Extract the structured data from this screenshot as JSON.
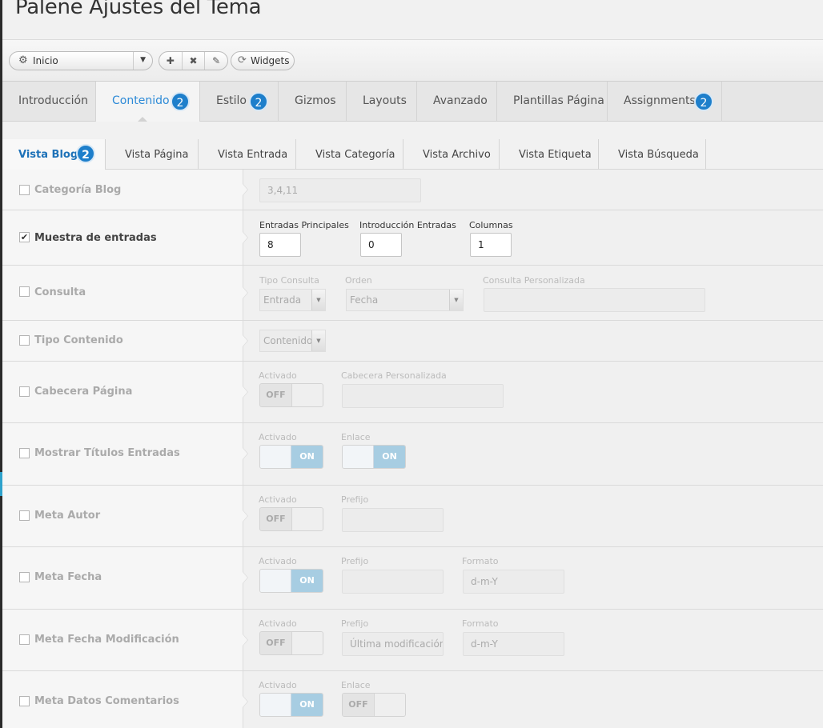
{
  "page_title": "Palene Ajustes del Tema",
  "toolbar": {
    "outline_select": "Inicio",
    "add_label": "✚",
    "delete_label": "✖",
    "edit_label": "✎",
    "widgets_label": "Widgets"
  },
  "main_tabs": [
    {
      "label": "Introducción",
      "badge": ""
    },
    {
      "label": "Contenido",
      "badge": "2"
    },
    {
      "label": "Estilo",
      "badge": "2"
    },
    {
      "label": "Gizmos",
      "badge": ""
    },
    {
      "label": "Layouts",
      "badge": ""
    },
    {
      "label": "Avanzado",
      "badge": ""
    },
    {
      "label": "Plantillas Página",
      "badge": ""
    },
    {
      "label": "Assignments",
      "badge": "2"
    }
  ],
  "sub_tabs": [
    {
      "label": "Vista Blog",
      "badge": "2"
    },
    {
      "label": "Vista Página"
    },
    {
      "label": "Vista Entrada"
    },
    {
      "label": "Vista Categoría"
    },
    {
      "label": "Vista Archivo"
    },
    {
      "label": "Vista Etiqueta"
    },
    {
      "label": "Vista Búsqueda"
    }
  ],
  "rows": {
    "categoria_blog": {
      "label": "Categoría Blog",
      "checked": false,
      "value": "3,4,11"
    },
    "muestra_entradas": {
      "label": "Muestra de entradas",
      "checked": true,
      "entradas_principales_label": "Entradas Principales",
      "entradas_principales": "8",
      "introduccion_label": "Introducción Entradas",
      "introduccion": "0",
      "columnas_label": "Columnas",
      "columnas": "1"
    },
    "consulta": {
      "label": "Consulta",
      "checked": false,
      "tipo_label": "Tipo Consulta",
      "tipo": "Entrada",
      "orden_label": "Orden",
      "orden": "Fecha",
      "personalizada_label": "Consulta Personalizada",
      "personalizada": ""
    },
    "tipo_contenido": {
      "label": "Tipo Contenido",
      "checked": false,
      "value": "Contenido"
    },
    "cabecera_pagina": {
      "label": "Cabecera Página",
      "checked": false,
      "activado_label": "Activado",
      "activado": "OFF",
      "personalizada_label": "Cabecera Personalizada",
      "personalizada": ""
    },
    "titulos_entradas": {
      "label": "Mostrar Títulos Entradas",
      "checked": false,
      "activado_label": "Activado",
      "activado": "ON",
      "enlace_label": "Enlace",
      "enlace": "ON"
    },
    "meta_autor": {
      "label": "Meta Autor",
      "checked": false,
      "activado_label": "Activado",
      "activado": "OFF",
      "prefijo_label": "Prefijo",
      "prefijo": ""
    },
    "meta_fecha": {
      "label": "Meta Fecha",
      "checked": false,
      "activado_label": "Activado",
      "activado": "ON",
      "prefijo_label": "Prefijo",
      "prefijo": "",
      "formato_label": "Formato",
      "formato": "d-m-Y"
    },
    "meta_fecha_mod": {
      "label": "Meta Fecha Modificación",
      "checked": false,
      "activado_label": "Activado",
      "activado": "OFF",
      "prefijo_label": "Prefijo",
      "prefijo": "Última modificación",
      "formato_label": "Formato",
      "formato": "d-m-Y"
    },
    "meta_comentarios": {
      "label": "Meta Datos Comentarios",
      "checked": false,
      "activado_label": "Activado",
      "activado": "ON",
      "enlace_label": "Enlace",
      "enlace": "OFF"
    }
  },
  "colors": {
    "accent": "#2d8ad7",
    "badge": "#1e7fcb",
    "toggle_on": "#a7cde2"
  }
}
